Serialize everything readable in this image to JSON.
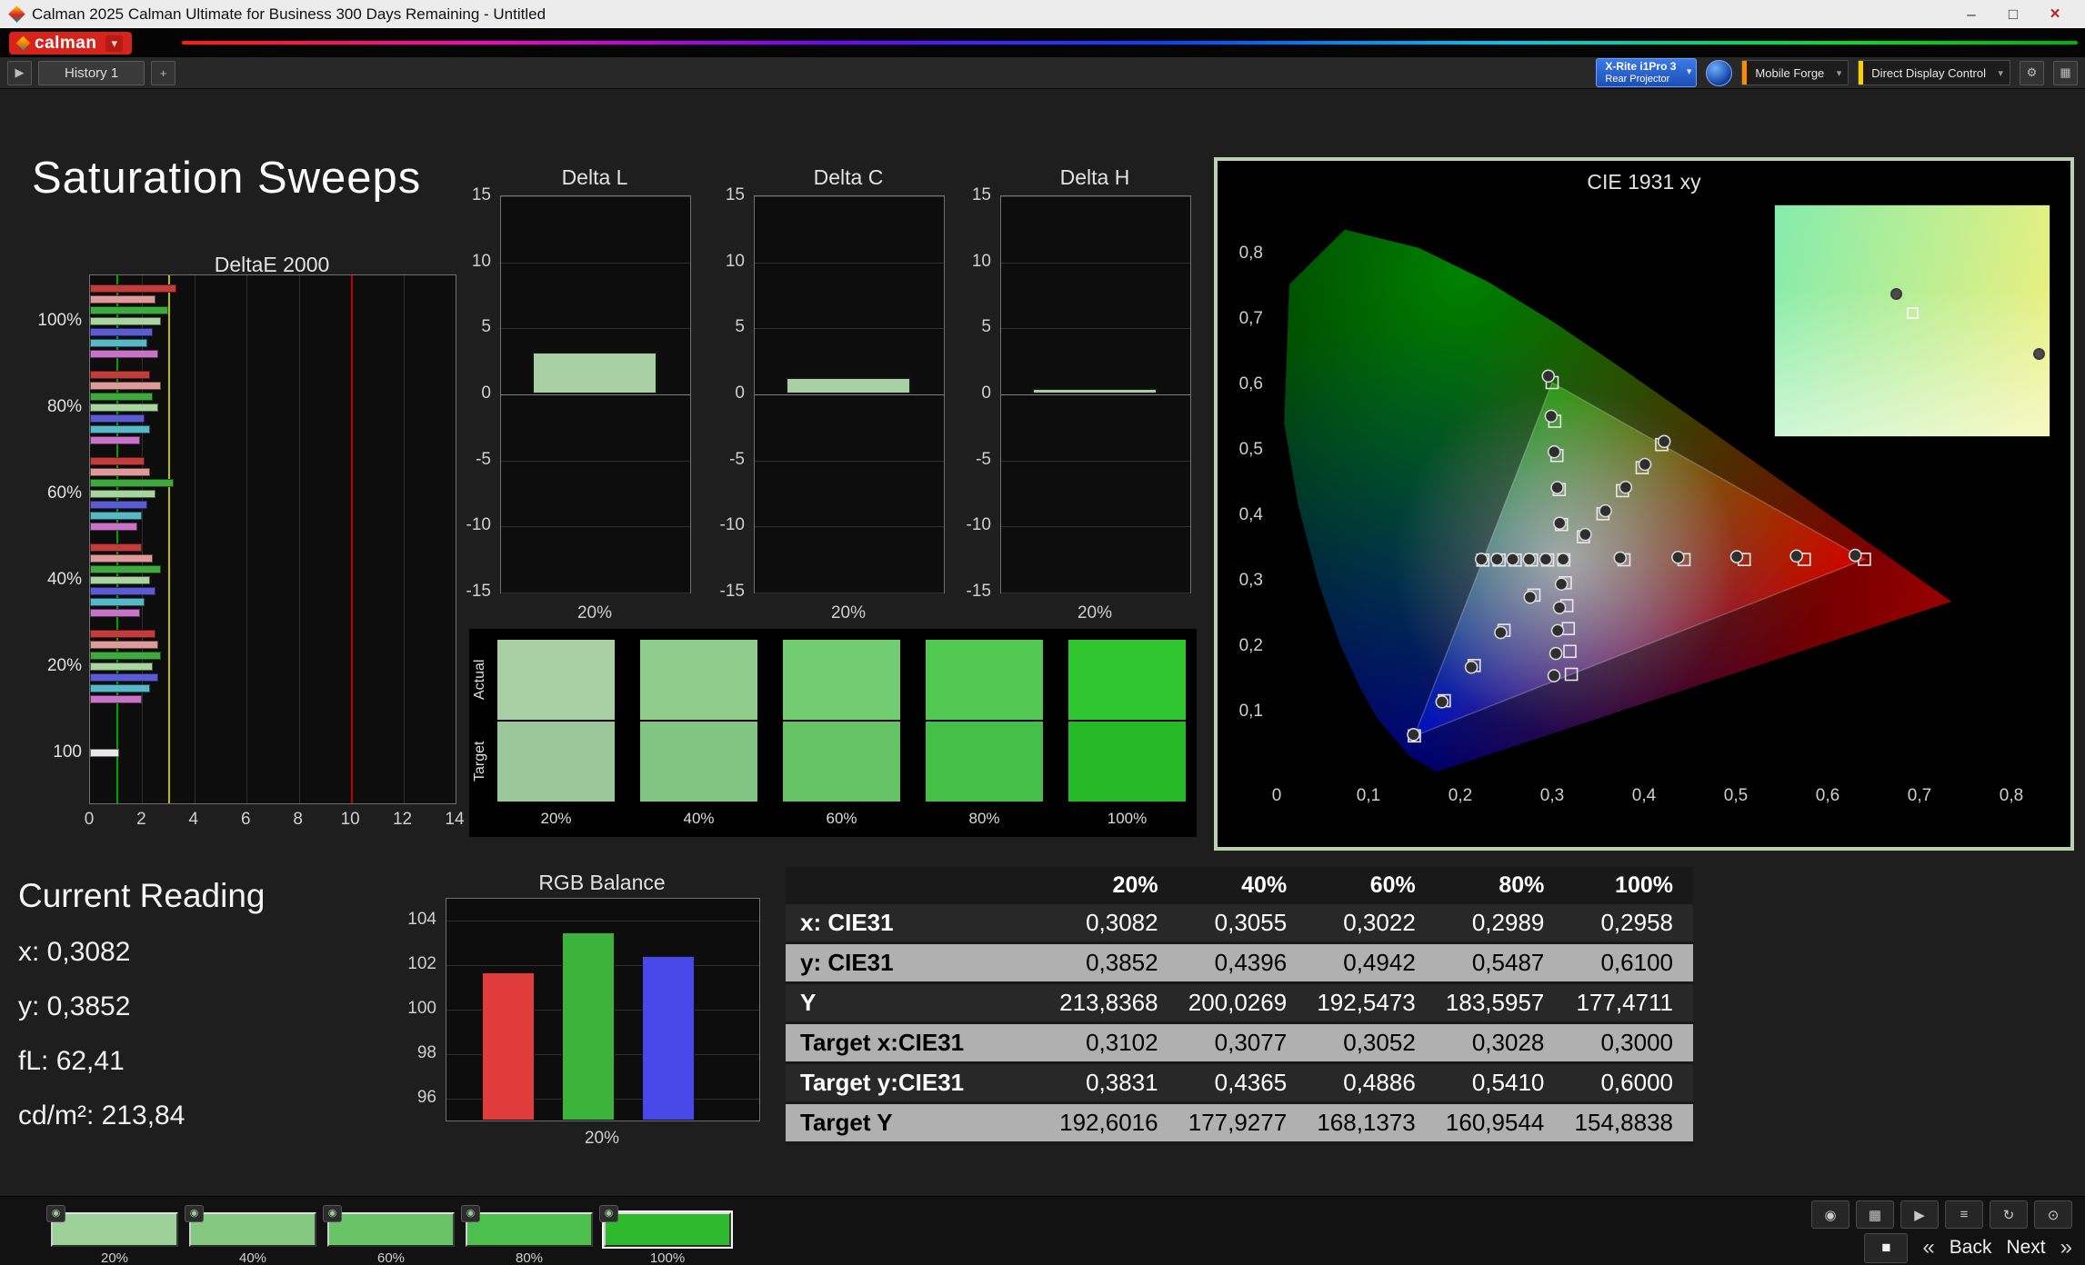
{
  "window": {
    "title": "Calman 2025 Calman Ultimate for Business 300 Days Remaining  - Untitled",
    "controls": {
      "minimize": "–",
      "maximize": "□",
      "close": "×"
    }
  },
  "brand": {
    "logo": "calman"
  },
  "icons": {
    "caret": "▾",
    "gear": "⚙",
    "workspace": "▦",
    "advance": "▶",
    "add": "+",
    "stop": "■",
    "prev": "«",
    "next": "»",
    "swatch_meter": "◉"
  },
  "toolbar": {
    "history_tab": "History 1",
    "meter": {
      "line1": "X-Rite i1Pro 3",
      "line2": "Rear Projector"
    },
    "source": "Mobile Forge",
    "display": "Direct Display Control",
    "source_accent": "#ff8800",
    "display_accent": "#ffd000"
  },
  "page_title": "Saturation Sweeps",
  "current_reading": {
    "title": "Current Reading",
    "x": "x: 0,3082",
    "y": "y: 0,3852",
    "fl": "fL: 62,41",
    "cdm2": "cd/m²: 213,84"
  },
  "swatch_panel": {
    "row_labels": [
      "Actual",
      "Target"
    ],
    "items": [
      {
        "label": "20%",
        "actual": "#a9cfa4",
        "target": "#9cc79a"
      },
      {
        "label": "40%",
        "actual": "#8ecd8c",
        "target": "#81c583"
      },
      {
        "label": "60%",
        "actual": "#72cc71",
        "target": "#65c366"
      },
      {
        "label": "80%",
        "actual": "#52c953",
        "target": "#46bf48"
      },
      {
        "label": "100%",
        "actual": "#2fc62f",
        "target": "#26ba28"
      }
    ]
  },
  "table": {
    "columns": [
      "",
      "20%",
      "40%",
      "60%",
      "80%",
      "100%"
    ],
    "rows": [
      {
        "label": "x: CIE31",
        "shade": "dark",
        "values": [
          "0,3082",
          "0,3055",
          "0,3022",
          "0,2989",
          "0,2958"
        ]
      },
      {
        "label": "y: CIE31",
        "shade": "light",
        "values": [
          "0,3852",
          "0,4396",
          "0,4942",
          "0,5487",
          "0,6100"
        ]
      },
      {
        "label": "Y",
        "shade": "dark",
        "values": [
          "213,8368",
          "200,0269",
          "192,5473",
          "183,5957",
          "177,4711"
        ]
      },
      {
        "label": "Target x:CIE31",
        "shade": "light",
        "values": [
          "0,3102",
          "0,3077",
          "0,3052",
          "0,3028",
          "0,3000"
        ]
      },
      {
        "label": "Target y:CIE31",
        "shade": "dark",
        "values": [
          "0,3831",
          "0,4365",
          "0,4886",
          "0,5410",
          "0,6000"
        ]
      },
      {
        "label": "Target Y",
        "shade": "light",
        "values": [
          "192,6016",
          "177,9277",
          "168,1373",
          "160,9544",
          "154,8838"
        ]
      }
    ]
  },
  "bottom_bar": {
    "swatches": [
      {
        "label": "20%",
        "color": "#9dd098",
        "selected": false
      },
      {
        "label": "40%",
        "color": "#84c881",
        "selected": false
      },
      {
        "label": "60%",
        "color": "#69c467",
        "selected": false
      },
      {
        "label": "80%",
        "color": "#4dbf4c",
        "selected": false
      },
      {
        "label": "100%",
        "color": "#2fba2e",
        "selected": true
      }
    ],
    "aux_buttons": [
      {
        "name": "capture-button",
        "glyph": "◉"
      },
      {
        "name": "layout-button",
        "glyph": "▦"
      },
      {
        "name": "play-button",
        "glyph": "▶"
      },
      {
        "name": "list-button",
        "glyph": "≡"
      },
      {
        "name": "refresh-button",
        "glyph": "↻"
      },
      {
        "name": "power-button",
        "glyph": "⊙"
      }
    ],
    "back_label": "Back",
    "next_label": "Next"
  },
  "chart_data": [
    {
      "id": "deltae2000",
      "type": "bar",
      "orientation": "horizontal",
      "title": "DeltaE 2000",
      "xlim": [
        0,
        14
      ],
      "xticks": [
        0,
        2,
        4,
        6,
        8,
        10,
        12,
        14
      ],
      "reference_lines": [
        {
          "value": 1,
          "color": "#00a500"
        },
        {
          "value": 3,
          "color": "#bdbd00"
        },
        {
          "value": 10,
          "color": "#c40000"
        }
      ],
      "groups": [
        {
          "label": "100%",
          "bars": [
            {
              "color": "#c43b3b",
              "value": 3.3
            },
            {
              "color": "#e09a9a",
              "value": 2.5
            },
            {
              "color": "#3fa83f",
              "value": 3.0
            },
            {
              "color": "#a8d4a0",
              "value": 2.7
            },
            {
              "color": "#5b5bd6",
              "value": 2.4
            },
            {
              "color": "#57b8c8",
              "value": 2.2
            },
            {
              "color": "#c873c8",
              "value": 2.6
            }
          ]
        },
        {
          "label": "80%",
          "bars": [
            {
              "color": "#c43b3b",
              "value": 2.3
            },
            {
              "color": "#e09a9a",
              "value": 2.7
            },
            {
              "color": "#3fa83f",
              "value": 2.4
            },
            {
              "color": "#a8d4a0",
              "value": 2.6
            },
            {
              "color": "#5b5bd6",
              "value": 2.1
            },
            {
              "color": "#57b8c8",
              "value": 2.3
            },
            {
              "color": "#c873c8",
              "value": 1.9
            }
          ]
        },
        {
          "label": "60%",
          "bars": [
            {
              "color": "#c43b3b",
              "value": 2.1
            },
            {
              "color": "#e09a9a",
              "value": 2.3
            },
            {
              "color": "#3fa83f",
              "value": 3.2
            },
            {
              "color": "#a8d4a0",
              "value": 2.5
            },
            {
              "color": "#5b5bd6",
              "value": 2.2
            },
            {
              "color": "#57b8c8",
              "value": 2.0
            },
            {
              "color": "#c873c8",
              "value": 1.8
            }
          ]
        },
        {
          "label": "40%",
          "bars": [
            {
              "color": "#c43b3b",
              "value": 2.0
            },
            {
              "color": "#e09a9a",
              "value": 2.4
            },
            {
              "color": "#3fa83f",
              "value": 2.7
            },
            {
              "color": "#a8d4a0",
              "value": 2.3
            },
            {
              "color": "#5b5bd6",
              "value": 2.5
            },
            {
              "color": "#57b8c8",
              "value": 2.1
            },
            {
              "color": "#c873c8",
              "value": 1.9
            }
          ]
        },
        {
          "label": "20%",
          "bars": [
            {
              "color": "#c43b3b",
              "value": 2.5
            },
            {
              "color": "#e09a9a",
              "value": 2.6
            },
            {
              "color": "#3fa83f",
              "value": 2.7
            },
            {
              "color": "#a8d4a0",
              "value": 2.4
            },
            {
              "color": "#5b5bd6",
              "value": 2.6
            },
            {
              "color": "#57b8c8",
              "value": 2.3
            },
            {
              "color": "#c873c8",
              "value": 2.0
            }
          ]
        },
        {
          "label": "100",
          "bars": [
            {
              "color": "#e8e8e8",
              "value": 1.1
            }
          ]
        }
      ]
    },
    {
      "id": "delta_l",
      "type": "bar",
      "title": "Delta L",
      "categories": [
        "20%"
      ],
      "values": [
        3.2
      ],
      "ylim": [
        -15,
        15
      ],
      "yticks": [
        15,
        10,
        5,
        0,
        -5,
        -10,
        -15
      ],
      "bar_color": "#a9cfa5"
    },
    {
      "id": "delta_c",
      "type": "bar",
      "title": "Delta C",
      "categories": [
        "20%"
      ],
      "values": [
        1.3
      ],
      "ylim": [
        -15,
        15
      ],
      "yticks": [
        15,
        10,
        5,
        0,
        -5,
        -10,
        -15
      ],
      "bar_color": "#a9cfa5"
    },
    {
      "id": "delta_h",
      "type": "bar",
      "title": "Delta H",
      "categories": [
        "20%"
      ],
      "values": [
        0.5
      ],
      "ylim": [
        -15,
        15
      ],
      "yticks": [
        15,
        10,
        5,
        0,
        -5,
        -10,
        -15
      ],
      "bar_color": "#a9cfa5"
    },
    {
      "id": "rgb_balance",
      "type": "bar",
      "title": "RGB Balance",
      "categories": [
        "20%"
      ],
      "ylim": [
        95,
        105
      ],
      "yticks": [
        104,
        102,
        100,
        98,
        96
      ],
      "series": [
        {
          "name": "Red",
          "color": "#e03c3c",
          "values": [
            101.7
          ]
        },
        {
          "name": "Green",
          "color": "#3cb43c",
          "values": [
            103.5
          ]
        },
        {
          "name": "Blue",
          "color": "#4848e8",
          "values": [
            102.4
          ]
        }
      ]
    },
    {
      "id": "cie1931",
      "type": "scatter",
      "title": "CIE 1931 xy",
      "xlim": [
        0,
        0.8
      ],
      "ylim": [
        0,
        0.8
      ],
      "xticks": [
        "0",
        "0,1",
        "0,2",
        "0,3",
        "0,4",
        "0,5",
        "0,6",
        "0,7",
        "0,8"
      ],
      "yticks": [
        "0",
        "0,1",
        "0,2",
        "0,3",
        "0,4",
        "0,5",
        "0,6",
        "0,7",
        "0,8"
      ],
      "series": [
        {
          "name": "white",
          "target": [
            [
              0.3127,
              0.329
            ]
          ],
          "measured": [
            [
              0.312,
              0.33
            ]
          ]
        },
        {
          "name": "red",
          "target": [
            [
              0.3782,
              0.3292
            ],
            [
              0.4436,
              0.3294
            ],
            [
              0.5091,
              0.3296
            ],
            [
              0.5745,
              0.3298
            ],
            [
              0.64,
              0.33
            ]
          ],
          "measured": [
            [
              0.374,
              0.332
            ],
            [
              0.437,
              0.333
            ],
            [
              0.501,
              0.334
            ],
            [
              0.566,
              0.335
            ],
            [
              0.63,
              0.336
            ]
          ]
        },
        {
          "name": "green",
          "target": [
            [
              0.3102,
              0.3831
            ],
            [
              0.3077,
              0.4365
            ],
            [
              0.3052,
              0.4886
            ],
            [
              0.3028,
              0.541
            ],
            [
              0.3,
              0.6
            ]
          ],
          "measured": [
            [
              0.3082,
              0.3852
            ],
            [
              0.3055,
              0.4396
            ],
            [
              0.3022,
              0.4942
            ],
            [
              0.2989,
              0.5487
            ],
            [
              0.2958,
              0.61
            ]
          ]
        },
        {
          "name": "blue",
          "target": [
            [
              0.2802,
              0.2752
            ],
            [
              0.2476,
              0.2214
            ],
            [
              0.2151,
              0.1676
            ],
            [
              0.1825,
              0.1138
            ],
            [
              0.15,
              0.06
            ]
          ],
          "measured": [
            [
              0.276,
              0.272
            ],
            [
              0.244,
              0.218
            ],
            [
              0.212,
              0.165
            ],
            [
              0.18,
              0.112
            ],
            [
              0.149,
              0.062
            ]
          ]
        },
        {
          "name": "cyan",
          "target": [
            [
              0.2951,
              0.3289
            ],
            [
              0.2775,
              0.3289
            ],
            [
              0.2598,
              0.3288
            ],
            [
              0.2422,
              0.3288
            ],
            [
              0.2246,
              0.3287
            ]
          ],
          "measured": [
            [
              0.293,
              0.33
            ],
            [
              0.275,
              0.33
            ],
            [
              0.257,
              0.33
            ],
            [
              0.24,
              0.33
            ],
            [
              0.223,
              0.33
            ]
          ]
        },
        {
          "name": "magenta",
          "target": [
            [
              0.3143,
              0.294
            ],
            [
              0.316,
              0.2591
            ],
            [
              0.3176,
              0.2241
            ],
            [
              0.3193,
              0.1892
            ],
            [
              0.3209,
              0.1542
            ]
          ],
          "measured": [
            [
              0.31,
              0.292
            ],
            [
              0.308,
              0.256
            ],
            [
              0.306,
              0.221
            ],
            [
              0.304,
              0.186
            ],
            [
              0.302,
              0.152
            ]
          ]
        },
        {
          "name": "yellow",
          "target": [
            [
              0.334,
              0.3643
            ],
            [
              0.3553,
              0.3995
            ],
            [
              0.3766,
              0.4348
            ],
            [
              0.398,
              0.47
            ],
            [
              0.4193,
              0.5053
            ]
          ],
          "measured": [
            [
              0.336,
              0.368
            ],
            [
              0.358,
              0.404
            ],
            [
              0.38,
              0.44
            ],
            [
              0.401,
              0.475
            ],
            [
              0.422,
              0.51
            ]
          ]
        }
      ],
      "inset": {
        "points": [
          {
            "type": "circle",
            "x_pct": 42,
            "y_pct": 36
          },
          {
            "type": "square",
            "x_pct": 48,
            "y_pct": 44
          },
          {
            "type": "circle",
            "x_pct": 94,
            "y_pct": 62
          }
        ]
      }
    }
  ]
}
